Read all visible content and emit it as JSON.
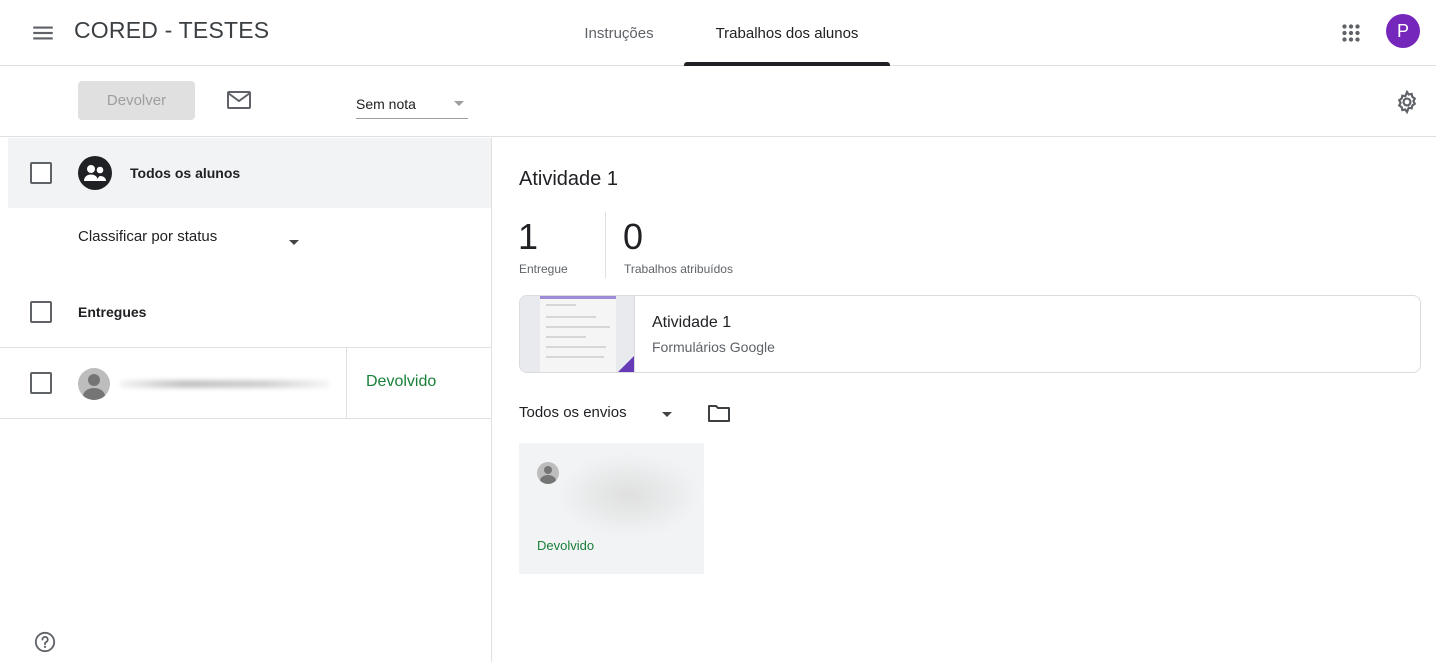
{
  "header": {
    "course_title": "CORED - TESTES",
    "tabs": [
      {
        "label": "Instruções",
        "active": false
      },
      {
        "label": "Trabalhos dos alunos",
        "active": true
      }
    ],
    "account_initial": "P",
    "account_color": "#7627bb"
  },
  "toolbar": {
    "return_label": "Devolver",
    "grade_filter": "Sem nota"
  },
  "sidebar": {
    "all_students_label": "Todos os alunos",
    "sort_label": "Classificar por status",
    "section_label": "Entregues",
    "students": [
      {
        "name": "",
        "status": "Devolvido"
      }
    ]
  },
  "assignment": {
    "title": "Atividade 1",
    "stats": [
      {
        "value": "1",
        "label": "Entregue"
      },
      {
        "value": "0",
        "label": "Trabalhos atribuídos"
      }
    ],
    "attachment": {
      "name": "Atividade 1",
      "type": "Formulários Google"
    },
    "submissions_filter": "Todos os envios",
    "submissions": [
      {
        "status": "Devolvido"
      }
    ]
  },
  "colors": {
    "returned_status": "#188038",
    "forms_accent": "#673ab7"
  },
  "icons": [
    "menu-icon",
    "apps-icon",
    "mail-icon",
    "settings-gear-icon",
    "group-icon",
    "person-icon",
    "folder-icon",
    "help-icon",
    "dropdown-arrow-icon"
  ]
}
